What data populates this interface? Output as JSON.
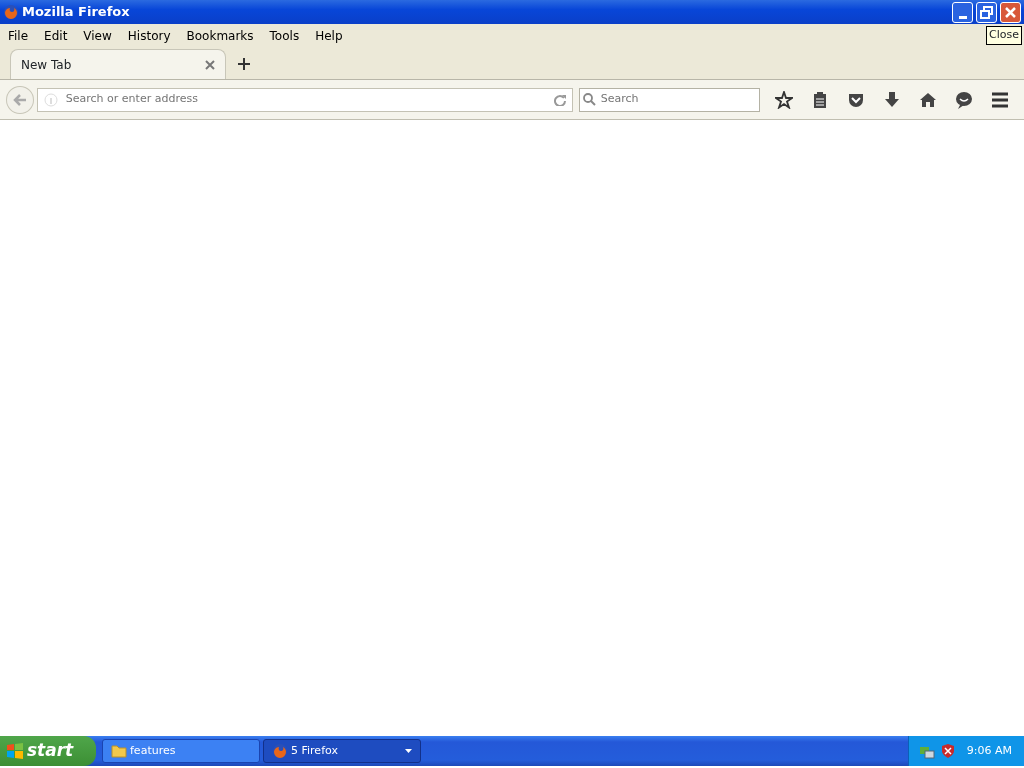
{
  "window": {
    "title": "Mozilla Firefox",
    "tooltip": "Close"
  },
  "menu": [
    "File",
    "Edit",
    "View",
    "History",
    "Bookmarks",
    "Tools",
    "Help"
  ],
  "tabs": [
    {
      "label": "New Tab",
      "selected": true
    }
  ],
  "address_bar": {
    "placeholder": "Search or enter address"
  },
  "search": {
    "placeholder": "Search"
  },
  "taskbar": {
    "start": "start",
    "buttons": [
      {
        "label": "features",
        "kind": "folder",
        "selected": false
      },
      {
        "label": "5 Firefox",
        "kind": "browser",
        "selected": true
      }
    ],
    "clock": "9:06 AM"
  }
}
